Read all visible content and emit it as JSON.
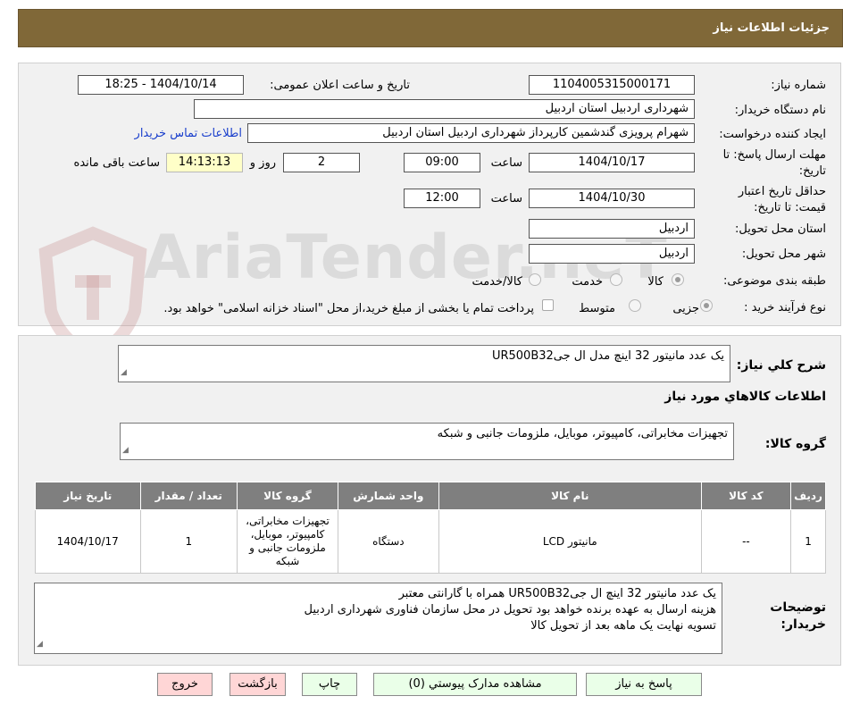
{
  "header": {
    "title": "جزئیات اطلاعات نیاز"
  },
  "form": {
    "need_number_label": "شماره نیاز:",
    "need_number": "1104005315000171",
    "announce_label": "تاریخ و ساعت اعلان عمومی:",
    "announce_value": "1404/10/14 - 18:25",
    "buyer_org_label": "نام دستگاه خریدار:",
    "buyer_org": "شهرداری اردبیل استان اردبیل",
    "requester_label": "ایجاد کننده درخواست:",
    "requester": "شهرام پرویزی گندشمین کارپرداز شهرداری اردبیل استان اردبیل",
    "contact_link": "اطلاعات تماس خریدار",
    "deadline_label_1": "مهلت ارسال پاسخ: تا",
    "deadline_label_2": "تاریخ:",
    "deadline_date": "1404/10/17",
    "time_label": "ساعت",
    "deadline_time": "09:00",
    "days_value": "2",
    "days_label": "روز و",
    "remaining_time": "14:13:13",
    "remaining_label": "ساعت باقی مانده",
    "validity_label_1": "حداقل تاریخ اعتبار",
    "validity_label_2": "قیمت: تا تاریخ:",
    "validity_date": "1404/10/30",
    "validity_time": "12:00",
    "province_label": "استان محل تحویل:",
    "province": "اردبیل",
    "city_label": "شهر محل تحویل:",
    "city": "اردبیل",
    "category_label": "طبقه بندی موضوعی:",
    "category_options": [
      "کالا",
      "خدمت",
      "کالا/خدمت"
    ],
    "category_selected": "کالا",
    "process_label": "نوع فرآیند خرید :",
    "process_options": [
      "جزیی",
      "متوسط"
    ],
    "process_selected": "جزیی",
    "payment_note": "پرداخت تمام یا بخشی از مبلغ خرید،از محل \"اسناد خزانه اسلامی\" خواهد بود."
  },
  "summary": {
    "label": "شرح کلي نیاز:",
    "value": "یک عدد مانیتور 32 اینچ  مدل ال جیUR500B32",
    "goods_section_title": "اطلاعات کالاهاي مورد نیاز",
    "group_label": "گروه کالا:",
    "group_value": "تجهیزات مخابراتی، کامپیوتر، موبایل، ملزومات جانبی و شبکه"
  },
  "table": {
    "headers": [
      "ردیف",
      "کد کالا",
      "نام کالا",
      "واحد شمارش",
      "گروه کالا",
      "تعداد / مقدار",
      "تاریخ نیاز"
    ],
    "rows": [
      {
        "row": "1",
        "code": "--",
        "name": "مانیتور LCD",
        "unit": "دستگاه",
        "group": "تجهیزات مخابراتی، کامپیوتر، موبایل، ملزومات جانبی و شبکه",
        "qty": "1",
        "date": "1404/10/17"
      }
    ]
  },
  "notes": {
    "label_1": "توضیحات",
    "label_2": "خریدار:",
    "lines": [
      "یک عدد مانیتور 32 اینچ ال جیUR500B32 همراه با گارانتی معتبر",
      "هزینه ارسال به عهده برنده خواهد بود تحویل در محل سازمان فناوری شهرداری اردبیل",
      "تسویه نهایت یک ماهه بعد از تحویل کالا"
    ]
  },
  "buttons": {
    "respond": "پاسخ به نیاز",
    "attachments": "مشاهده مدارک پیوستي (0)",
    "print": "چاپ",
    "back": "بازگشت",
    "exit": "خروج"
  },
  "watermark": {
    "text": "AriaTender.neT"
  },
  "colors": {
    "header_bg": "#806838",
    "link": "#1a3fcc",
    "table_header": "#7f7f7f"
  }
}
